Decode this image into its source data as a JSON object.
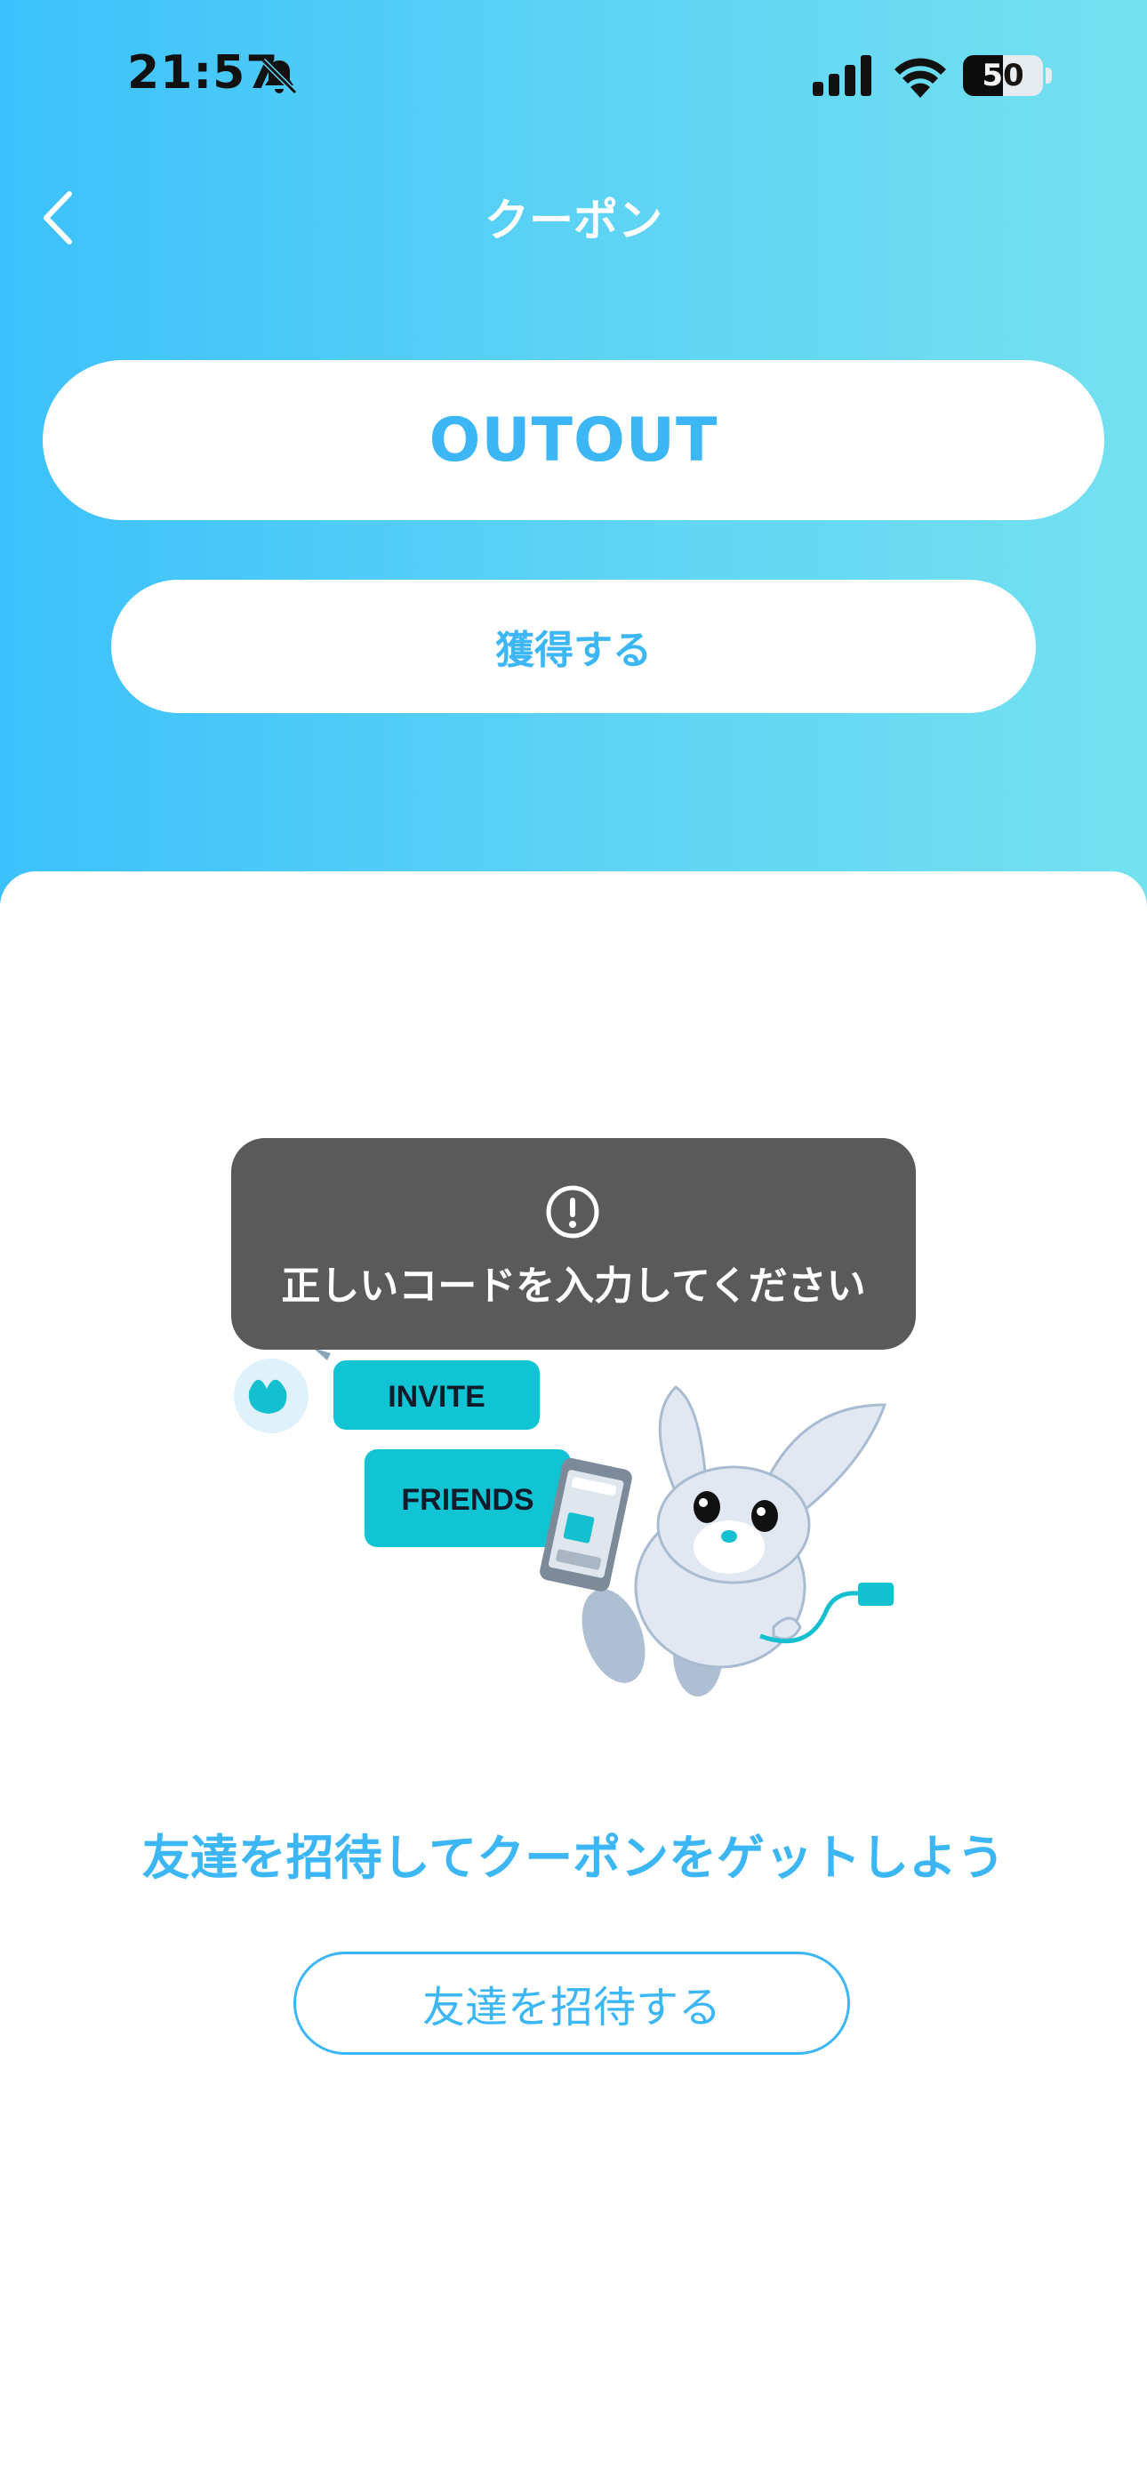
{
  "status_bar": {
    "time": "21:57",
    "battery": "50",
    "battery_fraction": 0.5,
    "icons": [
      "bell-slash-icon",
      "signal-icon",
      "wifi-icon",
      "battery-icon"
    ]
  },
  "nav": {
    "back_icon": "chevron-left-icon",
    "title": "クーポン"
  },
  "coupon": {
    "code_value": "OUTOUT",
    "acquire_label": "獲得する"
  },
  "toast": {
    "icon": "exclamation-circle-icon",
    "message": "正しいコードを入力してください"
  },
  "illustration": {
    "bubble_1": "INVITE",
    "bubble_2": "FRIENDS"
  },
  "invite": {
    "headline": "友達を招待してクーポンをゲットしよう",
    "button_label": "友達を招待する"
  },
  "colors": {
    "accent": "#3cb6f5",
    "gradient_start": "#3cc1fb",
    "gradient_end": "#74e1ef",
    "toast_bg": "#5a5a5a",
    "bubble": "#11c4d4"
  }
}
